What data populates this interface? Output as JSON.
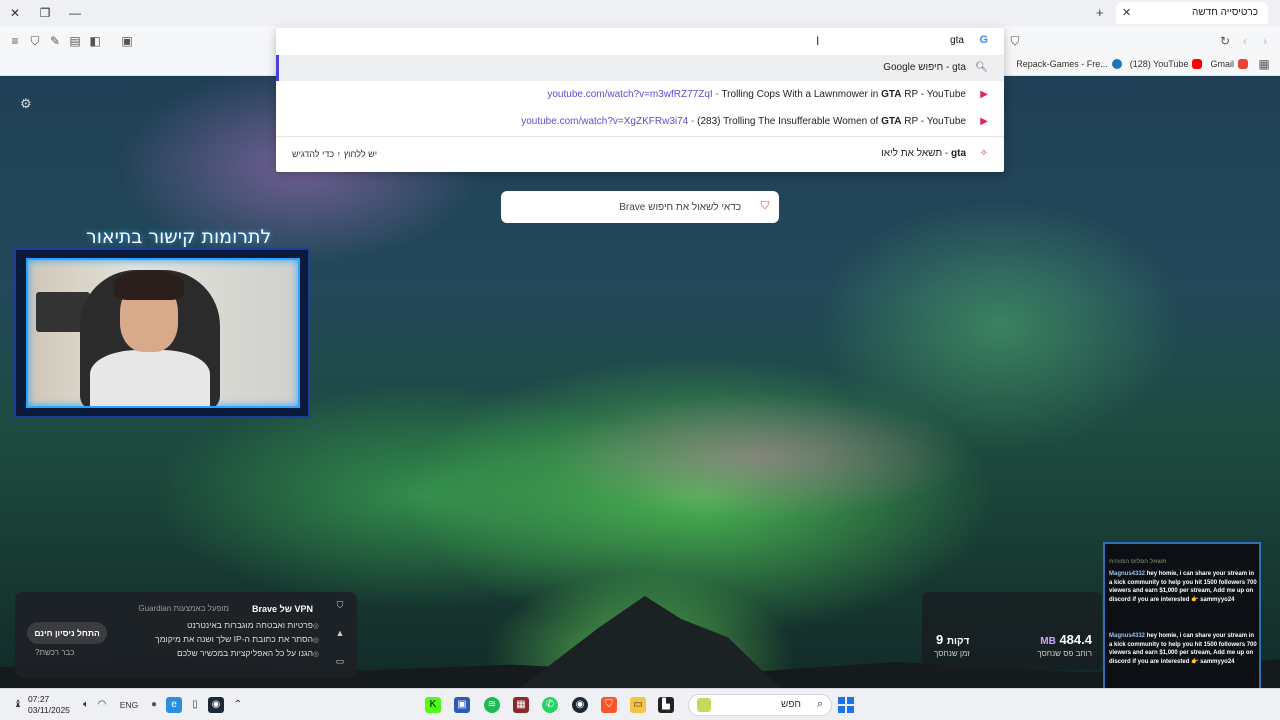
{
  "browser": {
    "tab_title": "כרטיסייה חדשה",
    "tab_close": "✕",
    "new_tab": "+",
    "window_close": "✕",
    "window_restore": "❐",
    "window_minimize": "—"
  },
  "omnibox": {
    "query": "gta",
    "suggestions": [
      {
        "text": "gta - חיפוש Google"
      },
      {
        "url": "youtube.com/watch?v=m3wfRZ77ZqI",
        "pre": "Trolling Cops With a Lawnmower in ",
        "bold": "GTA",
        "post": " RP - YouTube"
      },
      {
        "url": "youtube.com/watch?v=XgZKFRw3i74",
        "pre": "(283) Trolling The Insufferable Women of ",
        "bold": "GTA",
        "post": " RP - YouTube"
      },
      {
        "bold": "gta",
        "post": " - תשאל את ליאו",
        "hint": "יש ללחוץ ↑ כדי להדגיש"
      }
    ]
  },
  "bookmarks": [
    {
      "label": "Gmail",
      "color": "#ea4335"
    },
    {
      "label": "(128) YouTube",
      "color": "#ff0000"
    },
    {
      "label": "Repack-Games - Fre...",
      "color": "#1b75bb"
    }
  ],
  "leo_prompt": "כדאי לשאול את חיפוש Brave",
  "overlay": {
    "donate_text": "לתרומות קישור בתיאור"
  },
  "vpn": {
    "title": "VPN של Brave",
    "subtitle": "מופעל באמצעות Guardian",
    "features": [
      "פרטיות ואבטחה מוגברות באינטרנט",
      "הסתר את כתובת ה-IP שלך ושנה את מיקומך",
      "הגנו על כל האפליקציות במכשיר שלכם"
    ],
    "trial_button": "התחל ניסיון חינם",
    "already_bought": "כבר רכשת?"
  },
  "stats": {
    "bandwidth_value": "484.4",
    "bandwidth_unit": "MB",
    "bandwidth_label": "רוחב פס שנחסך",
    "time_value": "9",
    "time_unit": "דקות",
    "time_label": "זמן שנחסך"
  },
  "chat": {
    "header_faded": "תשאל הפלוס המוהיח",
    "messages": [
      {
        "user": "Magnus4332",
        "text": "hey homie, i can share your stream in a kick community to help you hit 1500 followers 700 viewers and earn $1,000 per stream, Add me up on discord if you are interested 👉 sammyyo24"
      },
      {
        "user": "Magnus4332",
        "text": "hey homie, i can share your stream in a kick community to help you hit 1500 followers 700 viewers and earn $1,000 per stream, Add me up on discord if you are interested 👉 sammyyo24"
      }
    ]
  },
  "taskbar": {
    "time": "07:27",
    "date": "03/11/2025",
    "language": "ENG",
    "search_placeholder": "חפש"
  }
}
